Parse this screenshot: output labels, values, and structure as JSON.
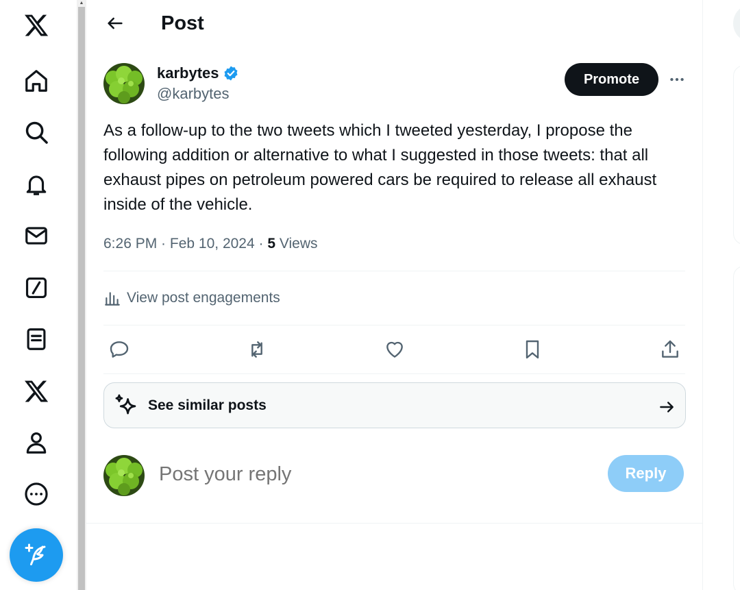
{
  "header": {
    "title": "Post"
  },
  "nav": {
    "items": [
      {
        "icon": "x-logo-icon"
      },
      {
        "icon": "home-icon"
      },
      {
        "icon": "search-icon"
      },
      {
        "icon": "bell-icon"
      },
      {
        "icon": "mail-icon"
      },
      {
        "icon": "grok-icon"
      },
      {
        "icon": "lists-icon"
      },
      {
        "icon": "premium-x-icon"
      },
      {
        "icon": "profile-icon"
      },
      {
        "icon": "more-circle-icon"
      }
    ],
    "compose_icon": "compose-post-icon"
  },
  "post": {
    "author_name": "karbytes",
    "author_handle": "@karbytes",
    "verified": true,
    "promote_label": "Promote",
    "text": "As a follow-up to the two tweets which I tweeted yesterday, I propose the following addition or alternative to what I suggested in those tweets: that all exhaust pipes on petroleum powered cars be required to release all exhaust inside of the vehicle.",
    "time": "6:26 PM",
    "date": "Feb 10, 2024",
    "views_count": "5",
    "views_label": "Views",
    "engagements_label": "View post engagements"
  },
  "similar": {
    "label": "See similar posts"
  },
  "reply": {
    "placeholder": "Post your reply",
    "button_label": "Reply"
  },
  "colors": {
    "accent": "#1d9bf0",
    "text": "#0f1419",
    "muted": "#536471",
    "reply_disabled": "#8ecdf8"
  }
}
